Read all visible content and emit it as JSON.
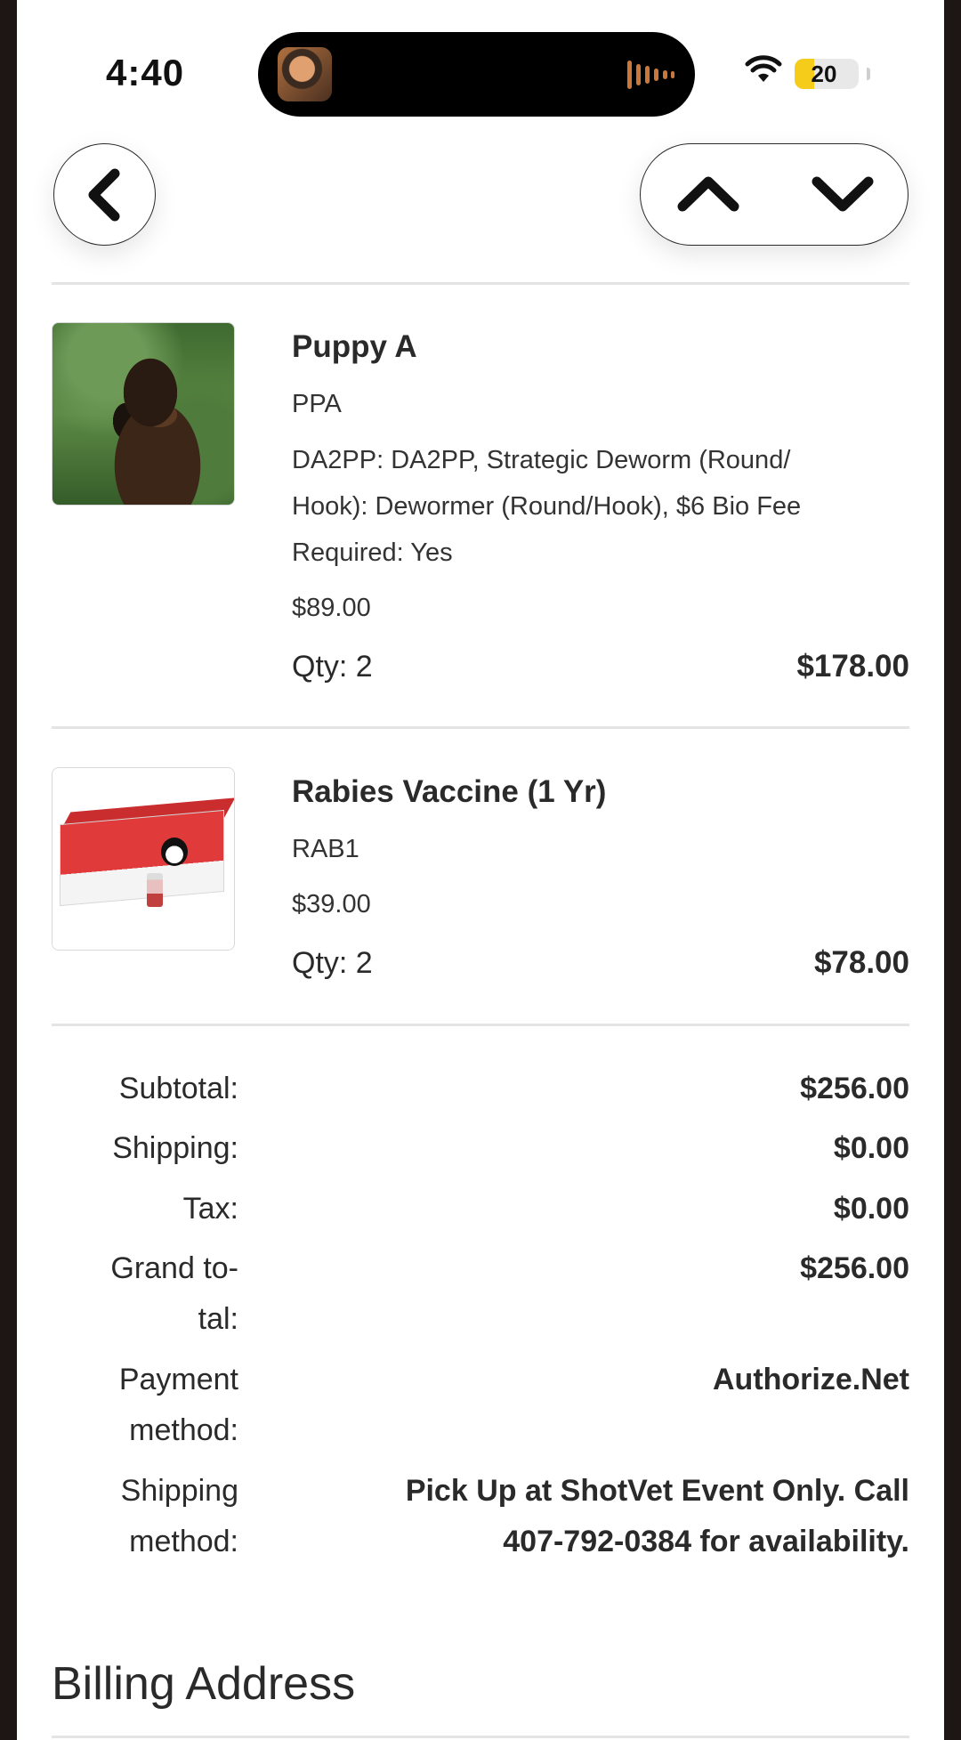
{
  "status_bar": {
    "time": "4:40",
    "battery": "20",
    "icons": [
      "now-playing-art",
      "audio-wave-icon",
      "wifi-icon",
      "battery-icon"
    ]
  },
  "nav": {
    "icons": [
      "chevron-left-icon",
      "chevron-up-icon",
      "chevron-down-icon"
    ]
  },
  "items": [
    {
      "title": "Puppy A",
      "sku": "PPA",
      "options_lines": [
        "DA2PP: DA2PP, Strategic Deworm (Round/",
        "Hook): Dewormer (Round/Hook), $6 Bio Fee",
        "Required: Yes"
      ],
      "price": "$89.00",
      "qty": "Qty: 2",
      "total": "$178.00"
    },
    {
      "title": "Rabies Vaccine (1 Yr)",
      "sku": "RAB1",
      "price": "$39.00",
      "qty": "Qty: 2",
      "total": "$78.00"
    }
  ],
  "summary": {
    "subtotal_label": "Subtotal:",
    "subtotal": "$256.00",
    "shipping_label": "Shipping:",
    "shipping": "$0.00",
    "tax_label": "Tax:",
    "tax": "$0.00",
    "grand_total_label_lines": [
      "Grand to-",
      "tal:"
    ],
    "grand_total": "$256.00",
    "payment_label_lines": [
      "Payment",
      "method:"
    ],
    "payment_method": "Authorize.Net",
    "shipping_method_label_lines": [
      "Shipping",
      "method:"
    ],
    "shipping_method_lines": [
      "Pick Up at ShotVet Event Only. Call",
      "407-792-0384 for availability."
    ]
  },
  "billing": {
    "title": "Billing Address"
  },
  "colors": {
    "battery_fill": "#f5cc1a",
    "island_wave": "#c9773a"
  }
}
